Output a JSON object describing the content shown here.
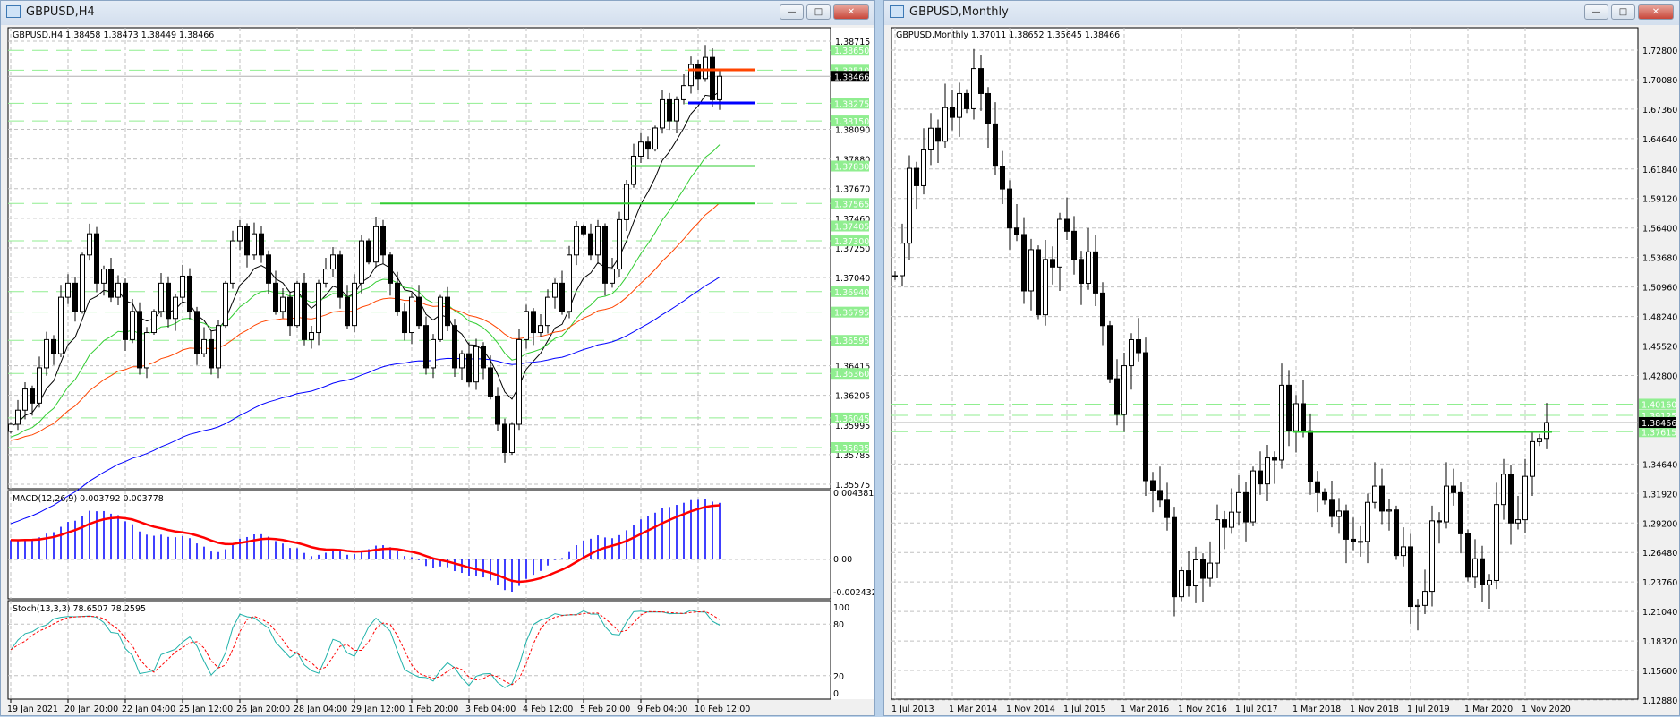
{
  "colors": {
    "level_line": "#90ee90",
    "level_label_bg": "#90ee90",
    "support": "#32cd32",
    "resistance": "#ff4500",
    "blue_level": "#0000ff",
    "bull": "#ffffff",
    "bear": "#000000",
    "macd_hist": "#0000ff",
    "macd_signal": "#ff0000",
    "stoch_main": "#20b2aa",
    "stoch_signal": "#ff0000",
    "ma_fast": "#000000",
    "ma_mid": "#32cd32",
    "ma_slow": "#ff4500",
    "ma_long": "#0000ff"
  },
  "left_window": {
    "title": "GBPUSD,H4",
    "buttons": {
      "minimize": "—",
      "maximize": "□",
      "close": "✕"
    },
    "chart_header": "GBPUSD,H4  1.38458 1.38473 1.38449 1.38466",
    "current_price": "1.38466",
    "macd_label": "MACD(12,26,9) 0.003792 0.003778",
    "macd_axis": [
      "0.004381",
      "0.00",
      "-0.002432"
    ],
    "stoch_label": "Stoch(13,3,3) 78.6507 78.2595",
    "stoch_axis": [
      "100",
      "80",
      "20",
      "0"
    ],
    "chart_data": {
      "type": "candlestick",
      "timeframe": "H4",
      "ylim": [
        1.35575,
        1.38715
      ],
      "price_ticks": [
        "1.38715",
        "1.38090",
        "1.37880",
        "1.37670",
        "1.37460",
        "1.37250",
        "1.37040",
        "1.36415",
        "1.36205",
        "1.35995",
        "1.35785",
        "1.35575"
      ],
      "time_labels": [
        "19 Jan 2021",
        "20 Jan 20:00",
        "22 Jan 04:00",
        "25 Jan 12:00",
        "26 Jan 20:00",
        "28 Jan 04:00",
        "29 Jan 12:00",
        "1 Feb 20:00",
        "3 Feb 04:00",
        "4 Feb 12:00",
        "5 Feb 20:00",
        "9 Feb 04:00",
        "10 Feb 12:00"
      ],
      "closes": [
        1.36,
        1.361,
        1.3625,
        1.3615,
        1.364,
        1.366,
        1.365,
        1.369,
        1.37,
        1.368,
        1.372,
        1.3735,
        1.37,
        1.371,
        1.369,
        1.37,
        1.366,
        1.368,
        1.364,
        1.3665,
        1.368,
        1.37,
        1.3675,
        1.369,
        1.3705,
        1.368,
        1.365,
        1.366,
        1.364,
        1.367,
        1.37,
        1.373,
        1.374,
        1.372,
        1.3735,
        1.372,
        1.37,
        1.368,
        1.369,
        1.367,
        1.37,
        1.366,
        1.3665,
        1.37,
        1.371,
        1.372,
        1.369,
        1.367,
        1.37,
        1.373,
        1.3715,
        1.374,
        1.372,
        1.37,
        1.368,
        1.3665,
        1.369,
        1.367,
        1.364,
        1.366,
        1.369,
        1.367,
        1.364,
        1.365,
        1.363,
        1.3655,
        1.364,
        1.362,
        1.36,
        1.358,
        1.36,
        1.366,
        1.368,
        1.3665,
        1.367,
        1.369,
        1.37,
        1.368,
        1.372,
        1.374,
        1.3735,
        1.372,
        1.374,
        1.37,
        1.371,
        1.3745,
        1.377,
        1.379,
        1.38,
        1.3795,
        1.381,
        1.383,
        1.3815,
        1.383,
        1.384,
        1.3855,
        1.3845,
        1.386,
        1.383,
        1.38466
      ],
      "first_open": 1.3595,
      "levels": [
        {
          "price": 1.3865,
          "label": "1.38650"
        },
        {
          "price": 1.3851,
          "label": "1.38510"
        },
        {
          "price": 1.38275,
          "label": "1.38275"
        },
        {
          "price": 1.3815,
          "label": "1.38150"
        },
        {
          "price": 1.3783,
          "label": "1.37830"
        },
        {
          "price": 1.37565,
          "label": "1.37565"
        },
        {
          "price": 1.37405,
          "label": "1.37405"
        },
        {
          "price": 1.373,
          "label": "1.37300"
        },
        {
          "price": 1.3694,
          "label": "1.36940"
        },
        {
          "price": 1.36795,
          "label": "1.36795"
        },
        {
          "price": 1.36595,
          "label": "1.36595"
        },
        {
          "price": 1.3636,
          "label": "1.36360"
        },
        {
          "price": 1.36045,
          "label": "1.36045"
        },
        {
          "price": 1.35835,
          "label": "1.35835"
        }
      ],
      "segments": [
        {
          "price": 1.38512,
          "from_index": 95,
          "color": "resistance"
        },
        {
          "price": 1.38277,
          "from_index": 95,
          "color": "blue_level"
        },
        {
          "price": 1.3783,
          "from_index": 87,
          "color": "support"
        },
        {
          "price": 1.37565,
          "from_index": 52,
          "color": "support"
        }
      ],
      "ma_seeds": {
        "ma_fast": 1.3598,
        "ma_mid": 1.359,
        "ma_slow": 1.3588,
        "ma_long": 1.3528
      }
    }
  },
  "right_window": {
    "title": "GBPUSD,Monthly",
    "buttons": {
      "minimize": "—",
      "maximize": "□",
      "close": "✕"
    },
    "chart_header": "GBPUSD,Monthly  1.37011 1.38652 1.35645 1.38466",
    "current_price": "1.38466",
    "chart_data": {
      "type": "candlestick",
      "timeframe": "Monthly",
      "ylim": [
        1.1288,
        1.728
      ],
      "price_ticks": [
        "1.72800",
        "1.70080",
        "1.67360",
        "1.64640",
        "1.61840",
        "1.59120",
        "1.56400",
        "1.53680",
        "1.50960",
        "1.48240",
        "1.45520",
        "1.42800",
        "1.34640",
        "1.31920",
        "1.29200",
        "1.26480",
        "1.23760",
        "1.21040",
        "1.18320",
        "1.15600",
        "1.12880"
      ],
      "time_labels": [
        "1 Jul 2013",
        "1 Mar 2014",
        "1 Nov 2014",
        "1 Jul 2015",
        "1 Mar 2016",
        "1 Nov 2016",
        "1 Jul 2017",
        "1 Mar 2018",
        "1 Nov 2018",
        "1 Jul 2019",
        "1 Mar 2020",
        "1 Nov 2020"
      ],
      "first_open": 1.52,
      "closes": [
        1.52,
        1.55,
        1.619,
        1.603,
        1.636,
        1.656,
        1.644,
        1.675,
        1.666,
        1.688,
        1.674,
        1.711,
        1.688,
        1.66,
        1.621,
        1.6,
        1.564,
        1.558,
        1.506,
        1.544,
        1.484,
        1.535,
        1.528,
        1.572,
        1.561,
        1.535,
        1.513,
        1.542,
        1.504,
        1.474,
        1.425,
        1.392,
        1.437,
        1.461,
        1.449,
        1.331,
        1.322,
        1.313,
        1.297,
        1.224,
        1.248,
        1.234,
        1.258,
        1.241,
        1.255,
        1.295,
        1.288,
        1.302,
        1.32,
        1.293,
        1.34,
        1.328,
        1.352,
        1.35,
        1.419,
        1.377,
        1.402,
        1.377,
        1.33,
        1.32,
        1.313,
        1.298,
        1.303,
        1.277,
        1.275,
        1.275,
        1.311,
        1.326,
        1.303,
        1.304,
        1.262,
        1.27,
        1.215,
        1.216,
        1.229,
        1.294,
        1.293,
        1.326,
        1.32,
        1.282,
        1.242,
        1.259,
        1.235,
        1.239,
        1.309,
        1.337,
        1.292,
        1.295,
        1.335,
        1.367,
        1.37,
        1.38466
      ],
      "levels": [
        {
          "price": 1.4016,
          "label": "1.40160"
        },
        {
          "price": 1.39125,
          "label": "1.39125"
        },
        {
          "price": 1.37615,
          "label": "1.37615"
        }
      ],
      "segments": [
        {
          "price": 1.37615,
          "from_index": 56,
          "color": "support"
        }
      ]
    }
  }
}
